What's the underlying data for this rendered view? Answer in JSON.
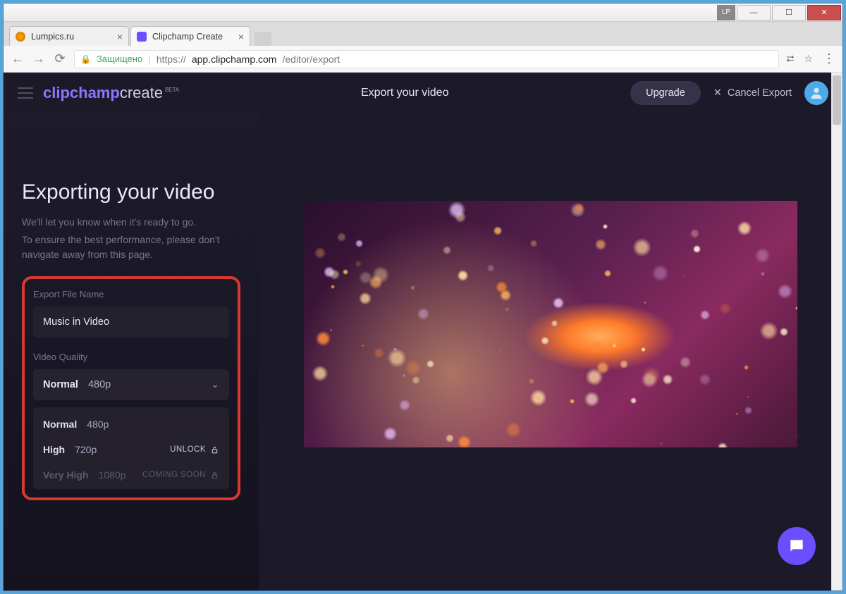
{
  "window": {
    "tabs": [
      {
        "title": "Lumpics.ru"
      },
      {
        "title": "Clipchamp Create"
      }
    ],
    "lp_badge": "LP"
  },
  "address": {
    "secure_label": "Защищено",
    "url_prefix": "https://",
    "url_host": "app.clipchamp.com",
    "url_path": "/editor/export"
  },
  "header": {
    "brand1": "clipchamp",
    "brand2": "create",
    "beta": "BETA",
    "center_title": "Export your video",
    "upgrade": "Upgrade",
    "cancel": "Cancel Export"
  },
  "sidebar": {
    "heading": "Exporting your video",
    "sub1": "We'll let you know when it's ready to go.",
    "sub2": "To ensure the best performance, please don't navigate away from this page.",
    "filename_label": "Export File Name",
    "filename_value": "Music in Video",
    "quality_label": "Video Quality",
    "selected": {
      "name": "Normal",
      "res": "480p"
    },
    "options": [
      {
        "name": "Normal",
        "res": "480p",
        "tag": ""
      },
      {
        "name": "High",
        "res": "720p",
        "tag": "UNLOCK"
      },
      {
        "name": "Very High",
        "res": "1080p",
        "tag": "COMING SOON"
      }
    ]
  }
}
